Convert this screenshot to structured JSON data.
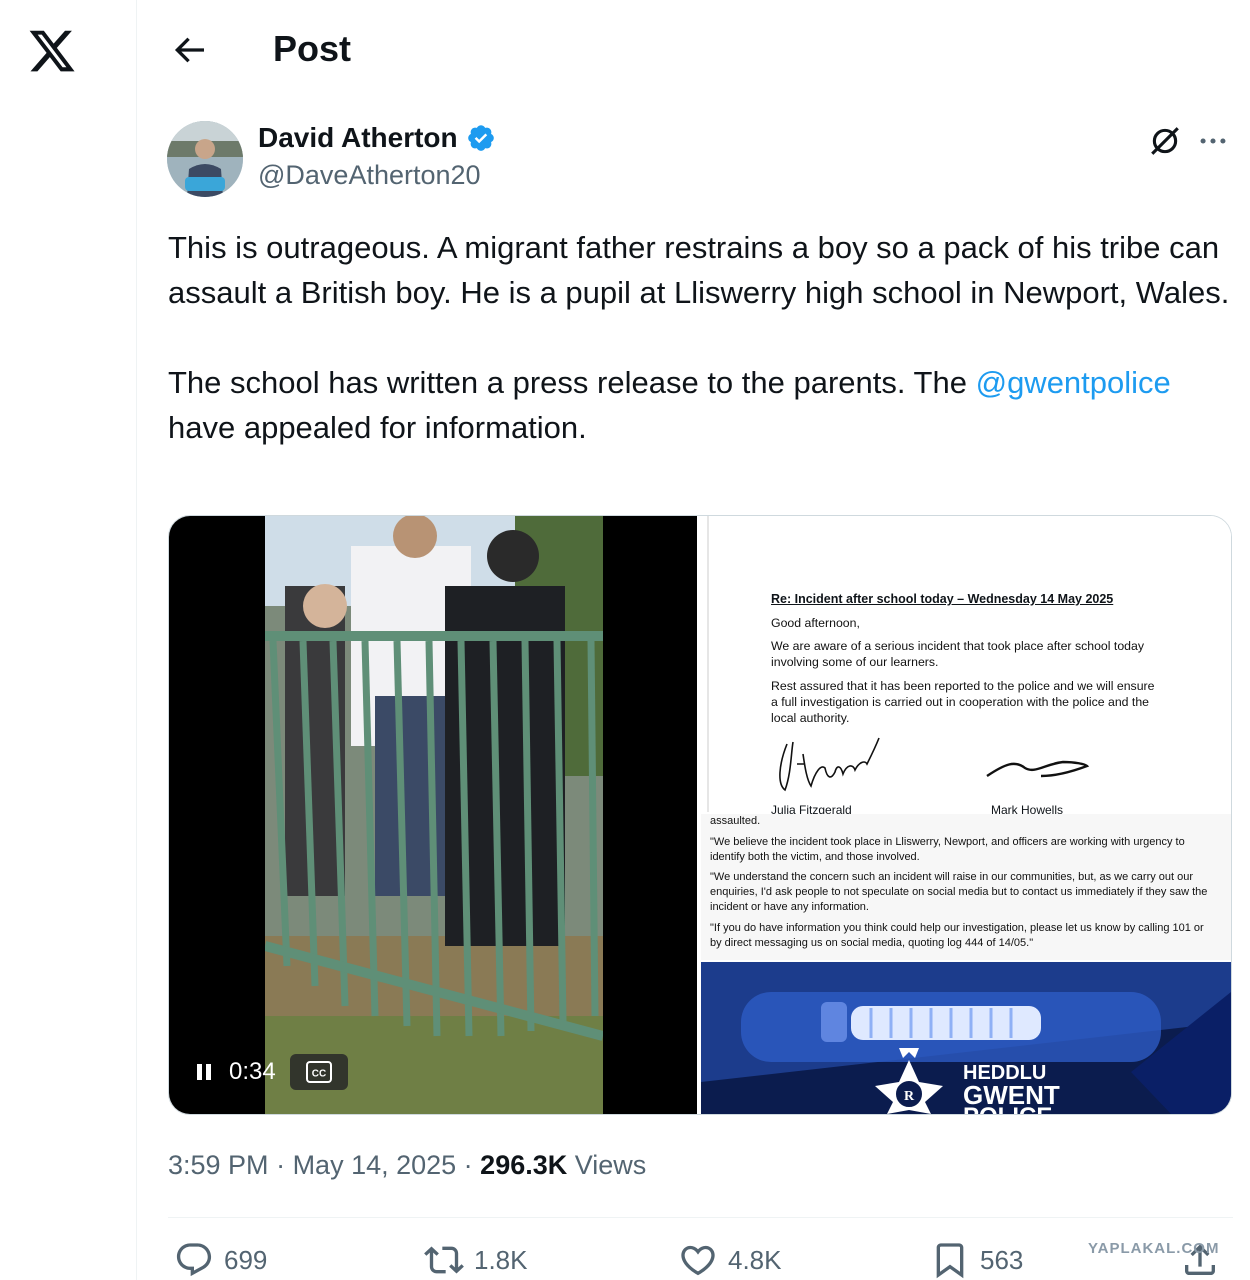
{
  "header": {
    "title": "Post"
  },
  "author": {
    "name": "David Atherton",
    "handle": "@DaveAtherton20",
    "verified": true
  },
  "tweet": {
    "paragraph1": "This is outrageous. A migrant father restrains a boy so a pack of his tribe can assault a British boy. He is a pupil at Lliswerry high school in Newport, Wales.",
    "paragraph2_before": "The school has written a press release to the parents. The ",
    "mention": "@gwentpolice",
    "paragraph2_after": " have appealed for information."
  },
  "video": {
    "time": "0:34",
    "cc_label": "CC"
  },
  "letter": {
    "heading": "Re: Incident after school today – Wednesday 14 May 2025",
    "greeting": "Good afternoon,",
    "para1": "We are aware of a serious incident that took place after school today involving some of our learners.",
    "para2": "Rest assured that it has been reported to the police and we will ensure a full investigation is carried out in cooperation with the police and the local authority.",
    "signatory1": "Julia Fitzgerald",
    "signatory2": "Mark Howells"
  },
  "statement": {
    "line0": "assaulted.",
    "line1": "\"We believe the incident took place in Lliswerry, Newport, and officers are working with urgency to identify both the victim, and those involved.",
    "line2": "\"We understand the concern such an incident will raise in our communities, but, as we carry out our enquiries, I'd ask people to not speculate on social media but to contact us immediately if they saw the incident or have any information.",
    "line3": "\"If you do have information you think could help our investigation, please let us know by calling 101 or by direct messaging us on social media, quoting log 444 of 14/05.\""
  },
  "banner": {
    "line1": "HEDDLU",
    "line2": "GWENT",
    "line3": "POLICE"
  },
  "meta": {
    "time": "3:59 PM",
    "sep1": " · ",
    "date": "May 14, 2025",
    "sep2": " · ",
    "views": "296.3K",
    "views_label": " Views"
  },
  "actions": {
    "replies": "699",
    "reposts": "1.8K",
    "likes": "4.8K",
    "bookmarks": "563"
  },
  "watermark": "YAPLAKAL.COM",
  "colors": {
    "accent": "#1d9bf0",
    "text": "#0f1419",
    "muted": "#536471",
    "border": "#cfd9de"
  }
}
